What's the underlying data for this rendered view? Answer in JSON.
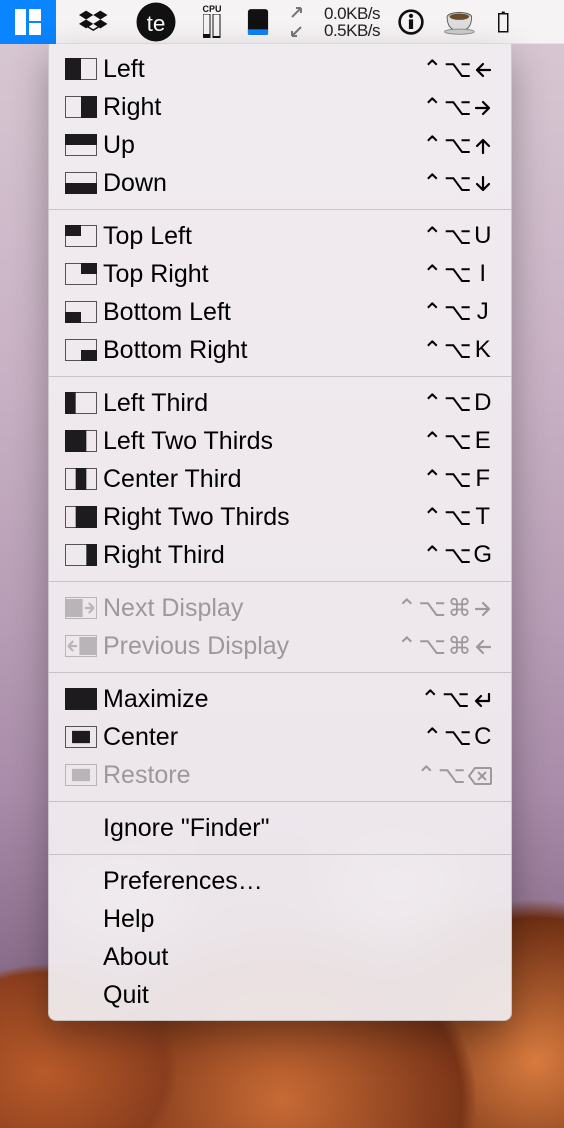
{
  "menubar": {
    "net_up": "0.0KB/s",
    "net_down": "0.5KB/s",
    "cpu_label": "CPU"
  },
  "shortcut_glyphs": {
    "ctrl": "⌃",
    "opt": "⌥",
    "cmd": "⌘"
  },
  "menu": {
    "sections": [
      [
        {
          "id": "left",
          "label": "Left",
          "icon": "half-left",
          "shortcut": [
            "ctrl",
            "opt",
            "arrow-left"
          ]
        },
        {
          "id": "right",
          "label": "Right",
          "icon": "half-right",
          "shortcut": [
            "ctrl",
            "opt",
            "arrow-right"
          ]
        },
        {
          "id": "up",
          "label": "Up",
          "icon": "half-top",
          "shortcut": [
            "ctrl",
            "opt",
            "arrow-up"
          ]
        },
        {
          "id": "down",
          "label": "Down",
          "icon": "half-bottom",
          "shortcut": [
            "ctrl",
            "opt",
            "arrow-down"
          ]
        }
      ],
      [
        {
          "id": "top-left",
          "label": "Top Left",
          "icon": "q-tl",
          "shortcut": [
            "ctrl",
            "opt",
            "U"
          ]
        },
        {
          "id": "top-right",
          "label": "Top Right",
          "icon": "q-tr",
          "shortcut": [
            "ctrl",
            "opt",
            "I"
          ]
        },
        {
          "id": "bottom-left",
          "label": "Bottom Left",
          "icon": "q-bl",
          "shortcut": [
            "ctrl",
            "opt",
            "J"
          ]
        },
        {
          "id": "bottom-right",
          "label": "Bottom Right",
          "icon": "q-br",
          "shortcut": [
            "ctrl",
            "opt",
            "K"
          ]
        }
      ],
      [
        {
          "id": "left-third",
          "label": "Left Third",
          "icon": "third-l",
          "shortcut": [
            "ctrl",
            "opt",
            "D"
          ]
        },
        {
          "id": "left-two-thirds",
          "label": "Left Two Thirds",
          "icon": "third-l2",
          "shortcut": [
            "ctrl",
            "opt",
            "E"
          ]
        },
        {
          "id": "center-third",
          "label": "Center Third",
          "icon": "third-c",
          "shortcut": [
            "ctrl",
            "opt",
            "F"
          ]
        },
        {
          "id": "right-two-thirds",
          "label": "Right Two Thirds",
          "icon": "third-r2",
          "shortcut": [
            "ctrl",
            "opt",
            "T"
          ]
        },
        {
          "id": "right-third",
          "label": "Right Third",
          "icon": "third-r",
          "shortcut": [
            "ctrl",
            "opt",
            "G"
          ]
        }
      ],
      [
        {
          "id": "next-display",
          "label": "Next Display",
          "icon": "disp-next",
          "shortcut": [
            "ctrl",
            "opt",
            "cmd",
            "arrow-right"
          ],
          "disabled": true
        },
        {
          "id": "previous-display",
          "label": "Previous Display",
          "icon": "disp-prev",
          "shortcut": [
            "ctrl",
            "opt",
            "cmd",
            "arrow-left"
          ],
          "disabled": true
        }
      ],
      [
        {
          "id": "maximize",
          "label": "Maximize",
          "icon": "full",
          "shortcut": [
            "ctrl",
            "opt",
            "return"
          ]
        },
        {
          "id": "center",
          "label": "Center",
          "icon": "center",
          "shortcut": [
            "ctrl",
            "opt",
            "C"
          ]
        },
        {
          "id": "restore",
          "label": "Restore",
          "icon": "restore",
          "shortcut": [
            "ctrl",
            "opt",
            "delete"
          ],
          "disabled": true
        }
      ],
      [
        {
          "id": "ignore",
          "label": "Ignore \"Finder\"",
          "no_icon": true
        }
      ],
      [
        {
          "id": "preferences",
          "label": "Preferences…",
          "no_icon": true
        },
        {
          "id": "help",
          "label": "Help",
          "no_icon": true
        },
        {
          "id": "about",
          "label": "About",
          "no_icon": true
        },
        {
          "id": "quit",
          "label": "Quit",
          "no_icon": true
        }
      ]
    ]
  }
}
